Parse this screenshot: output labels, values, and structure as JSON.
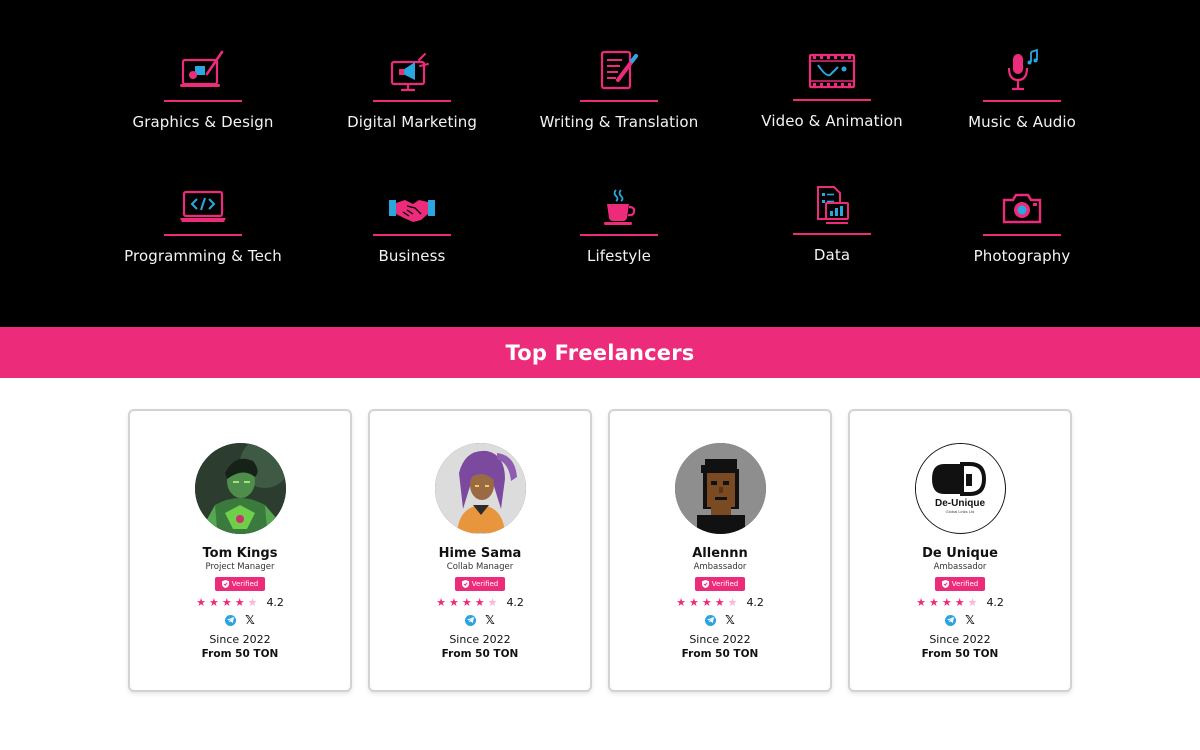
{
  "colors": {
    "accent": "#ec2b7b",
    "accent_light": "#f6b8d2",
    "dark_bg": "#000000",
    "icon_blue": "#29a8e0"
  },
  "categories": [
    {
      "label": "Graphics & Design",
      "icon": "design-tablet-icon"
    },
    {
      "label": "Digital Marketing",
      "icon": "marketing-megaphone-icon"
    },
    {
      "label": "Writing & Translation",
      "icon": "writing-pencil-icon"
    },
    {
      "label": "Video & Animation",
      "icon": "video-film-icon"
    },
    {
      "label": "Music & Audio",
      "icon": "microphone-icon"
    },
    {
      "label": "Programming & Tech",
      "icon": "code-laptop-icon"
    },
    {
      "label": "Business",
      "icon": "handshake-icon"
    },
    {
      "label": "Lifestyle",
      "icon": "coffee-cup-icon"
    },
    {
      "label": "Data",
      "icon": "data-chart-icon"
    },
    {
      "label": "Photography",
      "icon": "camera-icon"
    }
  ],
  "section": {
    "title": "Top Freelancers"
  },
  "freelancers": [
    {
      "name": "Tom Kings",
      "role": "Project Manager",
      "badge": "Verified",
      "rating": 4.2,
      "rating_label": "4.2",
      "stars_filled": 4,
      "since": "Since 2022",
      "price": "From 50 TON",
      "avatar_icon": "warrior-avatar"
    },
    {
      "name": "Hime Sama",
      "role": "Collab Manager",
      "badge": "Verified",
      "rating": 4.2,
      "rating_label": "4.2",
      "stars_filled": 4,
      "since": "Since 2022",
      "price": "From 50 TON",
      "avatar_icon": "anime-avatar"
    },
    {
      "name": "Allennn",
      "role": "Ambassador",
      "badge": "Verified",
      "rating": 4.2,
      "rating_label": "4.2",
      "stars_filled": 4,
      "since": "Since 2022",
      "price": "From 50 TON",
      "avatar_icon": "pixel-avatar"
    },
    {
      "name": "De Unique",
      "role": "Ambassador",
      "badge": "Verified",
      "rating": 4.2,
      "rating_label": "4.2",
      "stars_filled": 4,
      "since": "Since 2022",
      "price": "From 50 TON",
      "avatar_icon": "de-unique-logo",
      "logo_text": "De-Unique",
      "logo_subtext": "Global Links Ltd"
    }
  ]
}
